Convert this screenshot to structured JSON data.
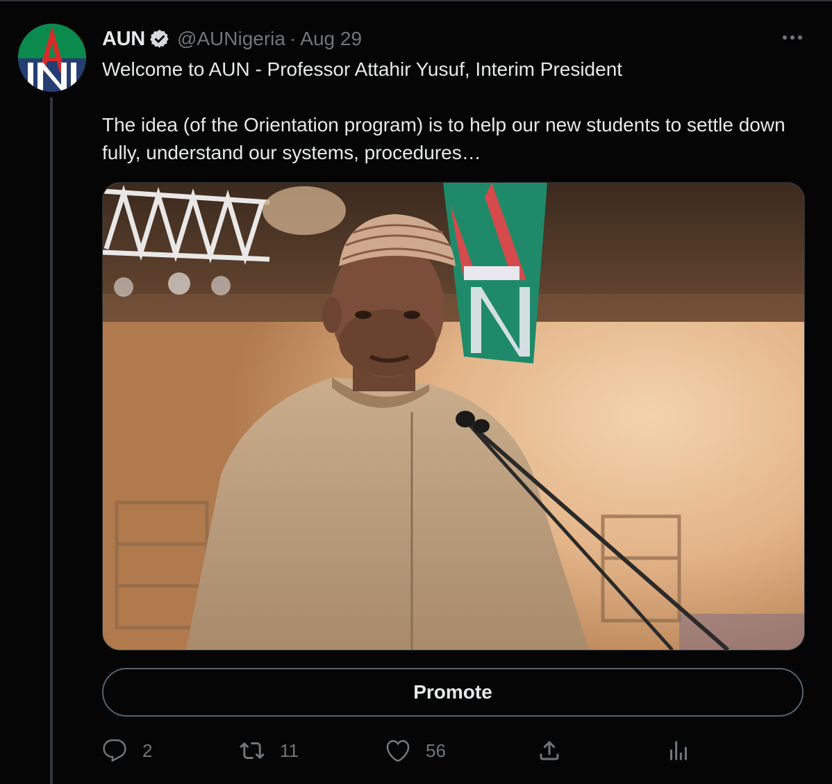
{
  "tweet": {
    "author_name": "AUN",
    "handle": "@AUNigeria",
    "separator": "·",
    "date": "Aug 29",
    "text_line1": "Welcome to AUN - Professor Attahir Yusuf, Interim President",
    "text_line2": "The idea (of the Orientation program) is to help our new students to settle down fully, understand our systems, procedures…"
  },
  "promote_label": "Promote",
  "actions": {
    "reply_count": "2",
    "retweet_count": "11",
    "like_count": "56"
  },
  "icons": {
    "verified": "verified-badge-icon",
    "more": "more-horizontal-icon",
    "reply": "reply-icon",
    "retweet": "retweet-icon",
    "like": "heart-icon",
    "share": "share-icon",
    "analytics": "analytics-icon"
  },
  "colors": {
    "background": "#000000",
    "text_primary": "#e7e9ea",
    "text_secondary": "#71767b",
    "border": "#2f3336",
    "brand_green": "#0a8a4c",
    "brand_red": "#d52b2b",
    "brand_navy": "#2a2f7a"
  }
}
